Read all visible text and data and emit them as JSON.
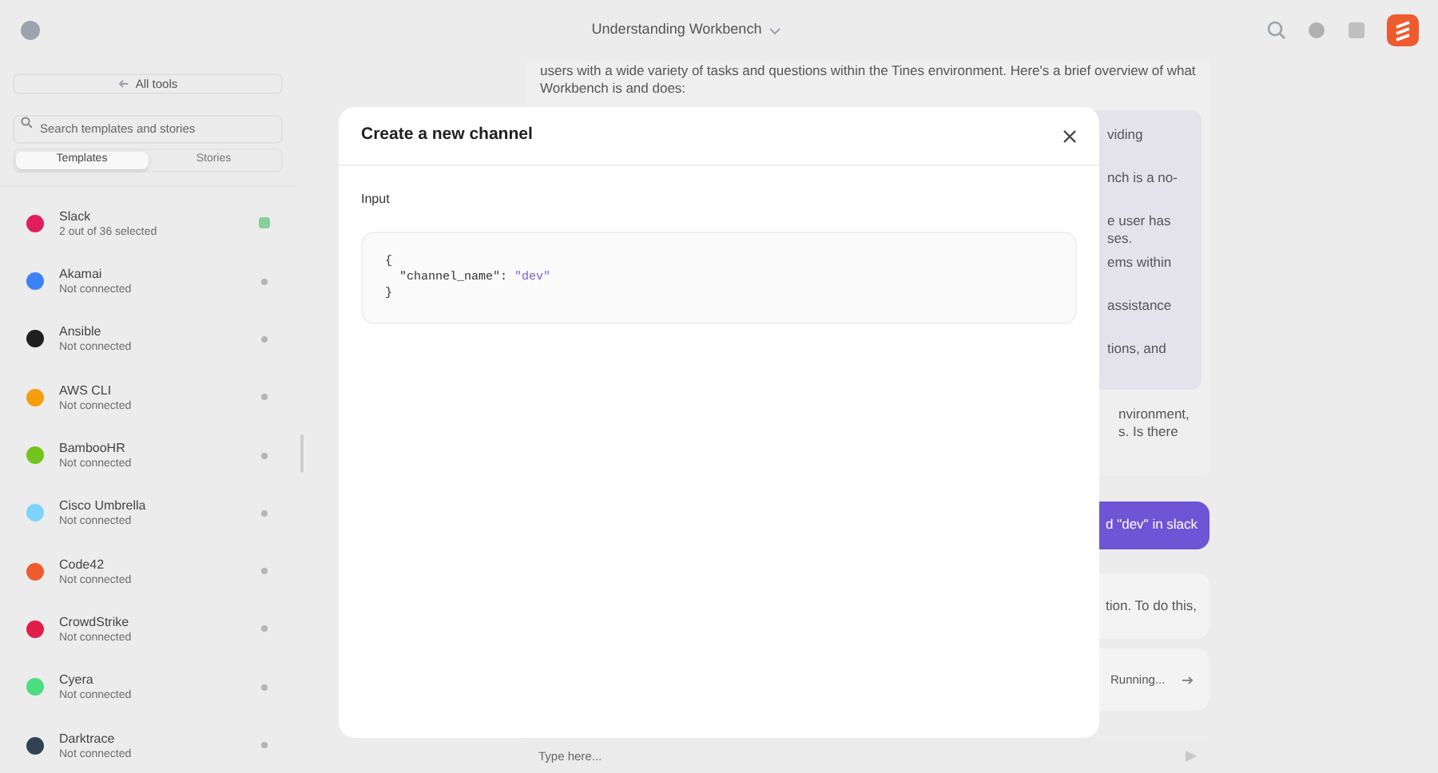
{
  "header": {
    "title": "Understanding Workbench"
  },
  "sidebar": {
    "all_tools": "All tools",
    "search": {
      "placeholder": "Search templates and stories"
    },
    "tabs": [
      {
        "label": "Templates",
        "selected": true
      },
      {
        "label": "Stories",
        "selected": false
      }
    ],
    "items": [
      {
        "name": "Slack",
        "status": "2 out of 36 selected",
        "connected": true,
        "color": "#e01e5a"
      },
      {
        "name": "Akamai",
        "status": "Not connected",
        "connected": false,
        "color": "#3b82f6"
      },
      {
        "name": "Ansible",
        "status": "Not connected",
        "connected": false,
        "color": "#1f1f1f"
      },
      {
        "name": "AWS CLI",
        "status": "Not connected",
        "connected": false,
        "color": "#f59e0b"
      },
      {
        "name": "BambooHR",
        "status": "Not connected",
        "connected": false,
        "color": "#73c41d"
      },
      {
        "name": "Cisco Umbrella",
        "status": "Not connected",
        "connected": false,
        "color": "#7dd3fc"
      },
      {
        "name": "Code42",
        "status": "Not connected",
        "connected": false,
        "color": "#ef5a2e"
      },
      {
        "name": "CrowdStrike",
        "status": "Not connected",
        "connected": false,
        "color": "#e11d48"
      },
      {
        "name": "Cyera",
        "status": "Not connected",
        "connected": false,
        "color": "#4ade80"
      },
      {
        "name": "Darktrace",
        "status": "Not connected",
        "connected": false,
        "color": "#334155"
      }
    ]
  },
  "chat": {
    "intro": "users with a wide variety of tasks and questions within the Tines environment. Here's a brief overview of what Workbench is and does:",
    "list_fragments": [
      "viding",
      "nch is a no-",
      "e user has",
      "ses.",
      "ems within",
      "assistance",
      "tions, and"
    ],
    "closing_fragments": [
      "nvironment,",
      "s. Is there"
    ],
    "user_message": "d \"dev\" in slack",
    "reply_fragment": "tion. To do this,",
    "tool_status": "Running...",
    "input": {
      "placeholder": "Type here..."
    }
  },
  "modal": {
    "title": "Create a new channel",
    "label": "Input",
    "code": {
      "open": "{",
      "key": "\"channel_name\":",
      "value": "\"dev\"",
      "close": "}"
    }
  }
}
